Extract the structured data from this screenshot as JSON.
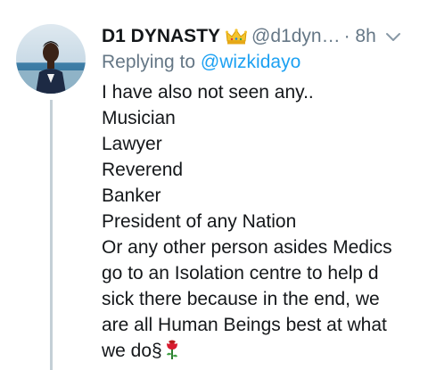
{
  "tweet": {
    "display_name": "D1 DYNASTY",
    "handle": "@d1dyn…",
    "time": "· 8h",
    "reply_prefix": "Replying to",
    "reply_to": "@wizkidayo",
    "body_lines": [
      "I have also not seen any..",
      "Musician",
      "Lawyer",
      "Reverend",
      "Banker",
      "President of any Nation",
      "Or any other person asides Medics",
      "go to an Isolation centre to help d",
      "sick there because in the end, we",
      "are all Human Beings best at what",
      "we do§"
    ],
    "emoji_name": "crown-icon",
    "end_emoji_name": "rose-icon"
  },
  "colors": {
    "name": "#14171a",
    "meta": "#657786",
    "link": "#1da1f2",
    "thread_line": "#c4cfd6"
  }
}
